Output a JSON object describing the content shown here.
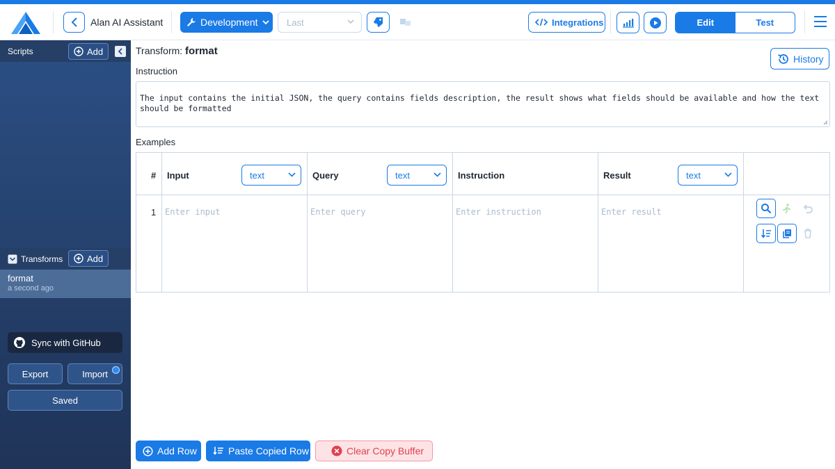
{
  "header": {
    "app_title": "Alan AI Assistant",
    "environment": "Development",
    "version_select": "Last",
    "integrations_label": "Integrations",
    "mode_tabs": [
      "Edit",
      "Test"
    ],
    "active_mode": "Edit"
  },
  "sidebar": {
    "scripts_label": "Scripts",
    "add_label": "Add",
    "transforms_label": "Transforms",
    "transforms": [
      {
        "name": "format",
        "time": "a second ago"
      }
    ],
    "sync_label": "Sync with GitHub",
    "export_label": "Export",
    "import_label": "Import",
    "saved_label": "Saved"
  },
  "main": {
    "title_prefix": "Transform:",
    "title_name": "format",
    "history_label": "History",
    "instruction_label": "Instruction",
    "instruction_text": "The input contains the initial JSON, the query contains fields description, the result shows what fields should be available and how the text should be formatted",
    "examples_label": "Examples",
    "table": {
      "num_header": "#",
      "columns": [
        {
          "label": "Input",
          "type": "text",
          "placeholder": "Enter input"
        },
        {
          "label": "Query",
          "type": "text",
          "placeholder": "Enter query"
        },
        {
          "label": "Instruction",
          "type": null,
          "placeholder": "Enter instruction"
        },
        {
          "label": "Result",
          "type": "text",
          "placeholder": "Enter result"
        }
      ],
      "rows": [
        {
          "num": "1"
        }
      ]
    },
    "bottom_buttons": {
      "add_row": "Add Row",
      "paste_row": "Paste Copied Row",
      "clear_buffer": "Clear Copy Buffer"
    }
  },
  "colors": {
    "accent": "#1a7ae6",
    "sidebar_bg": "#2b4f84",
    "danger": "#e0414f"
  }
}
